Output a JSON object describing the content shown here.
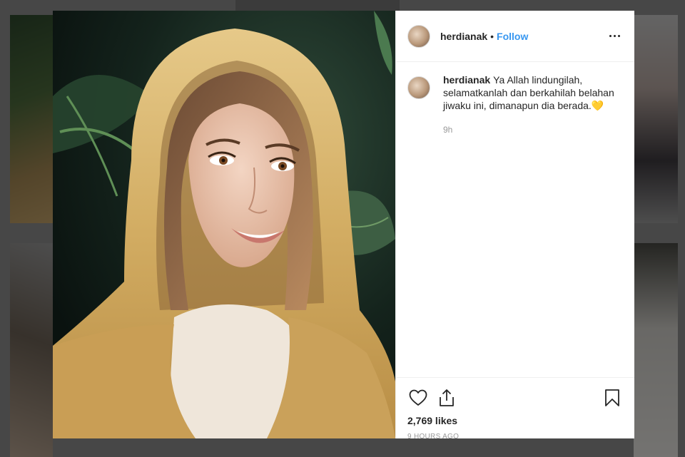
{
  "post": {
    "username": "herdianak",
    "separator": "•",
    "follow_label": "Follow",
    "caption": "Ya Allah lindungilah, selamatkanlah dan berkahilah belahan jiwaku ini, dimanapun dia berada.",
    "caption_emoji": "💛",
    "caption_age": "9h",
    "likes": "2,769 likes",
    "posted": "9 HOURS AGO"
  },
  "icons": {
    "more": "more-options-icon",
    "like": "heart-icon",
    "share": "share-icon",
    "save": "bookmark-icon"
  },
  "colors": {
    "link": "#3897f0",
    "text": "#262626",
    "muted": "#999999",
    "border": "#efefef"
  }
}
